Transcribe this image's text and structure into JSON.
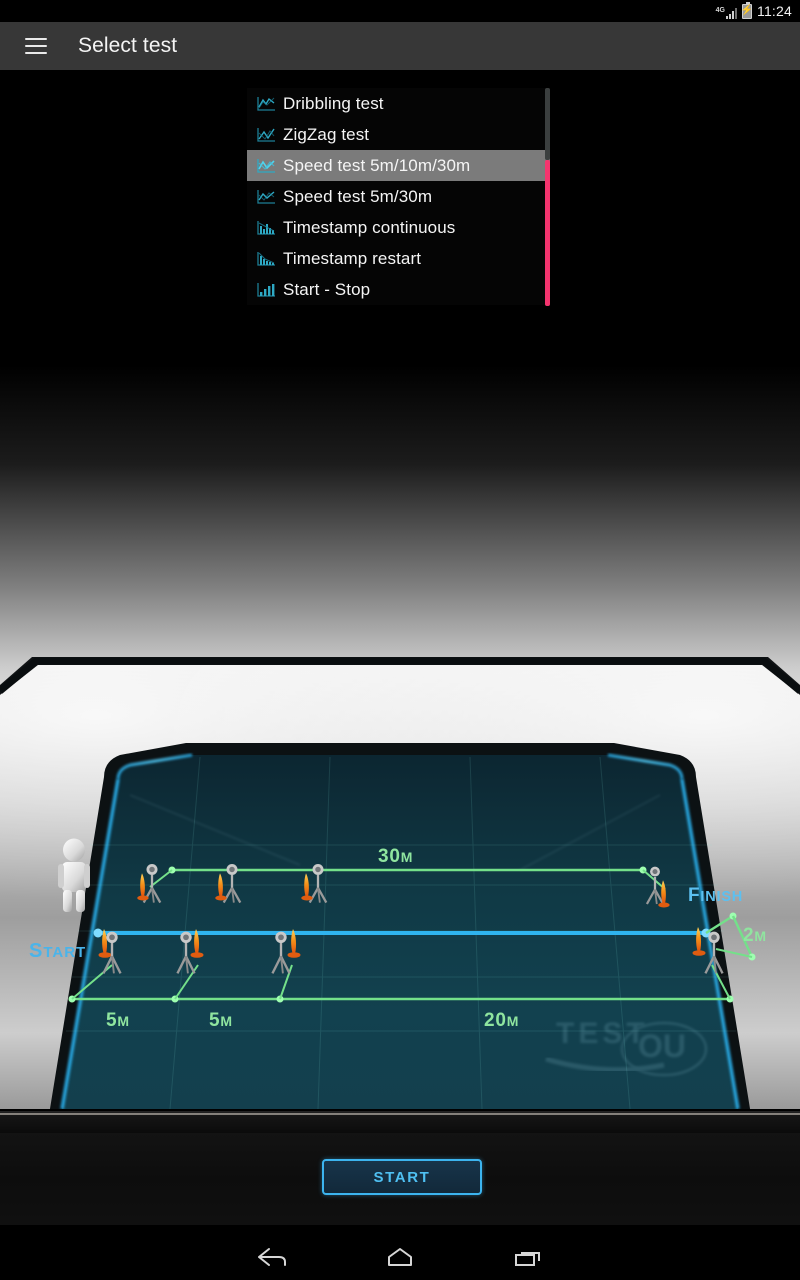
{
  "status_bar": {
    "network_label": "4G",
    "signal_icon": "signal-bars-icon",
    "battery_icon": "battery-charging-icon",
    "battery_glyph": "⚡",
    "clock": "11:24"
  },
  "app_bar": {
    "menu_icon": "hamburger-menu-icon",
    "title": "Select test"
  },
  "dropdown": {
    "selected_index": 2,
    "items": [
      {
        "label": "Dribbling test",
        "icon": "line-chart-icon"
      },
      {
        "label": "ZigZag test",
        "icon": "zigzag-chart-icon"
      },
      {
        "label": "Speed test 5m/10m/30m",
        "icon": "speed-chart-icon"
      },
      {
        "label": "Speed test 5m/30m",
        "icon": "line-chart-icon"
      },
      {
        "label": "Timestamp continuous",
        "icon": "bar-decline-chart-icon"
      },
      {
        "label": "Timestamp restart",
        "icon": "bar-drop-chart-icon"
      },
      {
        "label": "Start - Stop",
        "icon": "bar-chart-icon"
      }
    ],
    "scrollbar": {
      "track_color": "#3b3f3f",
      "thumb_color": "#f4346e"
    }
  },
  "illustration": {
    "start_label": "START",
    "finish_label": "FINISH",
    "watermark": "TESTYOU",
    "dimension_labels": [
      {
        "text": "30M"
      },
      {
        "text": "2M"
      },
      {
        "text": "5M"
      },
      {
        "text": "5M"
      },
      {
        "text": "20M"
      }
    ],
    "colors": {
      "run_line": "#2fb4ef",
      "dimension_line": "#74e08a",
      "dimension_text": "#8fe59f",
      "start_text": "#4ab4ea",
      "finish_text": "#4ab4ea",
      "cone": "#f07818",
      "runner": "#e8e8e8",
      "field": "#123340"
    },
    "gate_count_top": 4,
    "gate_count_bottom": 4
  },
  "action_bar": {
    "start_button": "START"
  },
  "nav_bar": {
    "buttons": [
      {
        "name": "back-icon"
      },
      {
        "name": "home-icon"
      },
      {
        "name": "recents-icon"
      }
    ]
  }
}
